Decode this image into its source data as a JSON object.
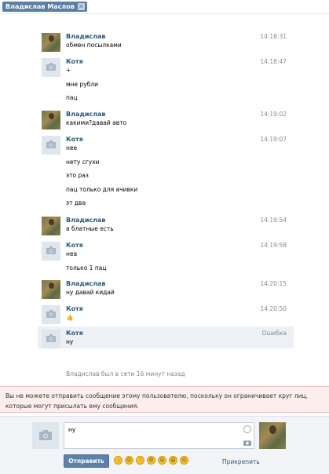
{
  "tab": {
    "title": "Владислав Маслов",
    "close": "✕"
  },
  "messages": [
    {
      "author": "Владислав",
      "avatar": "photo",
      "time": "14:18:31",
      "lines": [
        "обмен посылками"
      ]
    },
    {
      "author": "Котя",
      "avatar": "camera",
      "time": "14:18:47",
      "lines": [
        "+",
        "мне рубли",
        "пац"
      ]
    },
    {
      "author": "Владислав",
      "avatar": "photo",
      "time": "14:19:02",
      "lines": [
        "какими?давай авто"
      ]
    },
    {
      "author": "Котя",
      "avatar": "camera",
      "time": "14:19:07",
      "lines": [
        "нее",
        "нету сгухи",
        "это раз",
        "пац только для ачивки",
        "эт два"
      ]
    },
    {
      "author": "Владислав",
      "avatar": "photo",
      "time": "14:19:54",
      "lines": [
        "а блатные есть"
      ]
    },
    {
      "author": "Котя",
      "avatar": "camera",
      "time": "14:19:58",
      "lines": [
        "неа",
        "только 1 пац"
      ]
    },
    {
      "author": "Владислав",
      "avatar": "photo",
      "time": "14:20:15",
      "lines": [
        "ну давай кидай"
      ]
    },
    {
      "author": "Котя",
      "avatar": "camera",
      "time": "14:20:50",
      "lines": [
        "👍"
      ]
    },
    {
      "author": "Котя",
      "avatar": "camera",
      "time": "Ошибка",
      "lines": [
        "ну"
      ],
      "failed": true
    }
  ],
  "status": "Владислав был в сети 16 минут назад",
  "warning": "Вы не можете отправить сообщение этому пользователю, поскольку он ограничивает круг лиц, которые могут присылать ему сообщения.",
  "composer": {
    "text": "ну",
    "send_label": "Отправить",
    "attach_label": "Прикрепить",
    "emojis": [
      "👍",
      "😊",
      "👎",
      "😠",
      "😮",
      "😄",
      "😐"
    ]
  }
}
